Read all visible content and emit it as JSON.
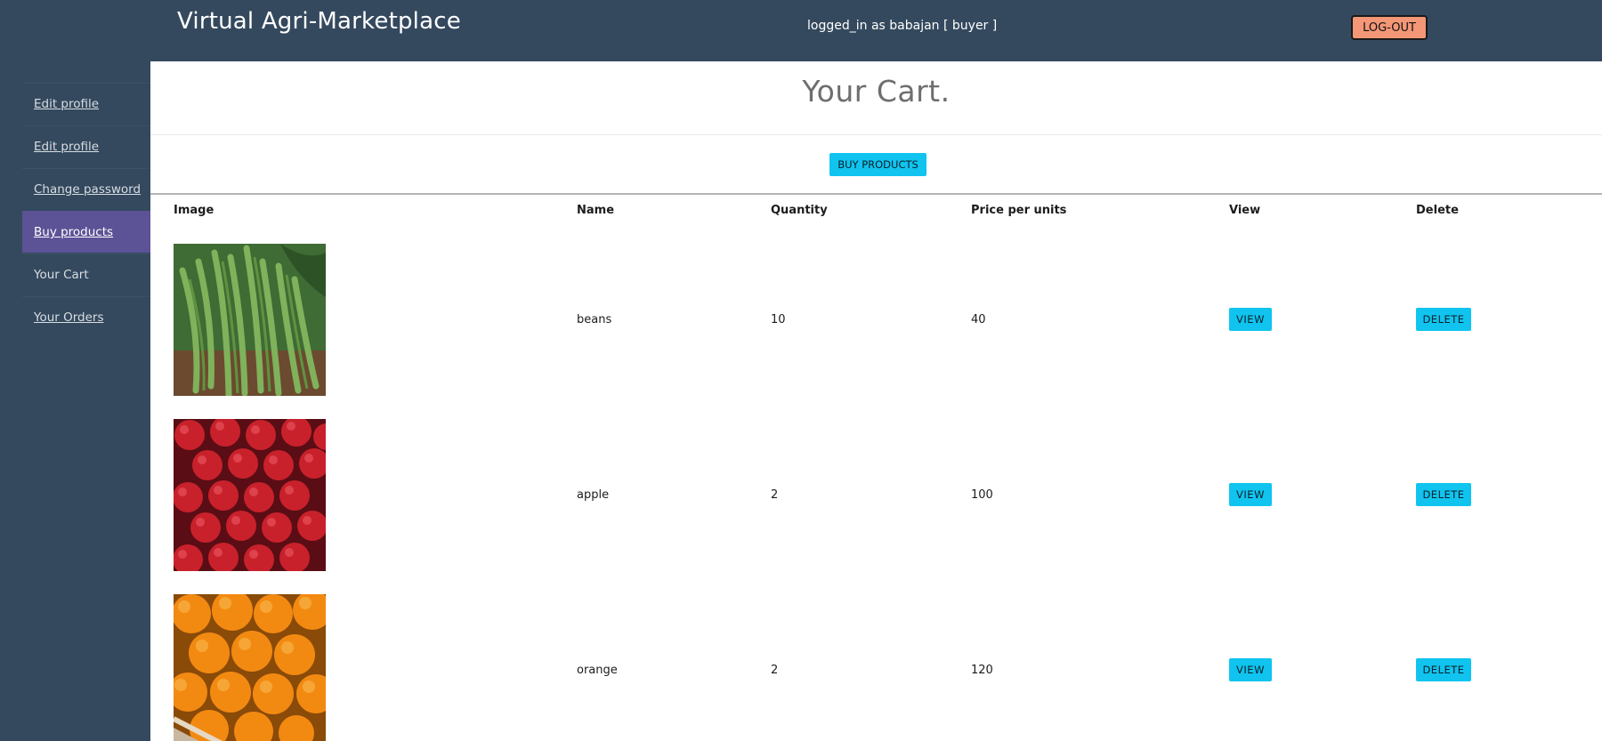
{
  "header": {
    "brand": "Virtual Agri-Marketplace",
    "logged_in_text": "logged_in as babajan [ buyer ]",
    "logout_label": "LOG-OUT"
  },
  "sidebar": {
    "items": [
      {
        "label": "Edit profile"
      },
      {
        "label": "Edit profile"
      },
      {
        "label": "Change password"
      },
      {
        "label": "Buy products"
      },
      {
        "label": "Your Cart"
      },
      {
        "label": "Your Orders"
      }
    ]
  },
  "main": {
    "title": "Your Cart.",
    "buy_button": "BUY PRODUCTS"
  },
  "table": {
    "headers": [
      "Image",
      "Name",
      "Quantity",
      "Price per units",
      "View",
      "Delete"
    ],
    "rows": [
      {
        "name": "beans",
        "quantity": "10",
        "price": "40",
        "view": "VIEW",
        "delete": "DELETE"
      },
      {
        "name": "apple",
        "quantity": "2",
        "price": "100",
        "view": "VIEW",
        "delete": "DELETE"
      },
      {
        "name": "orange",
        "quantity": "2",
        "price": "120",
        "view": "VIEW",
        "delete": "DELETE"
      }
    ]
  },
  "colors": {
    "nav_bg": "#34495e",
    "active_nav": "#5c5296",
    "accent_button": "#10c4ef",
    "logout_button": "#f39777"
  }
}
